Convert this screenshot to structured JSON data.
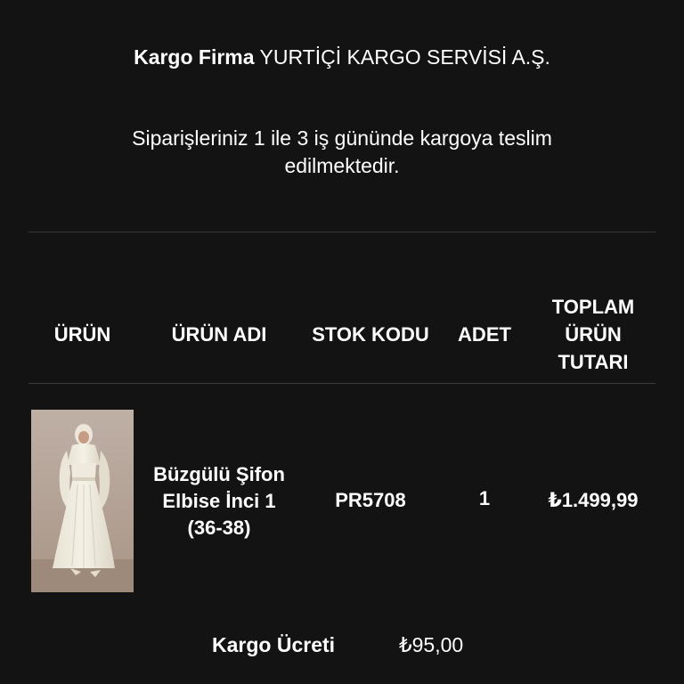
{
  "cargo": {
    "label": "Kargo Firma",
    "company": "YURTİÇİ KARGO SERVİSİ A.Ş."
  },
  "delivery_note": "Siparişleriniz 1 ile 3 iş gününde kargoya teslim edilmektedir.",
  "table": {
    "headers": {
      "product": "ÜRÜN",
      "product_name": "ÜRÜN ADI",
      "stock_code": "STOK KODU",
      "quantity": "ADET",
      "total": "TOPLAM ÜRÜN TUTARI"
    },
    "rows": [
      {
        "image_icon": "product-photo-icon",
        "name": "Büzgülü Şifon Elbise İnci 1 (36-38)",
        "stock_code": "PR5708",
        "quantity": "1",
        "total": "₺1.499,99"
      }
    ]
  },
  "shipping": {
    "label": "Kargo Ücreti",
    "value": "₺95,00"
  },
  "colors": {
    "background": "#141314",
    "text": "#ffffff",
    "divider": "#3b3a3b"
  }
}
